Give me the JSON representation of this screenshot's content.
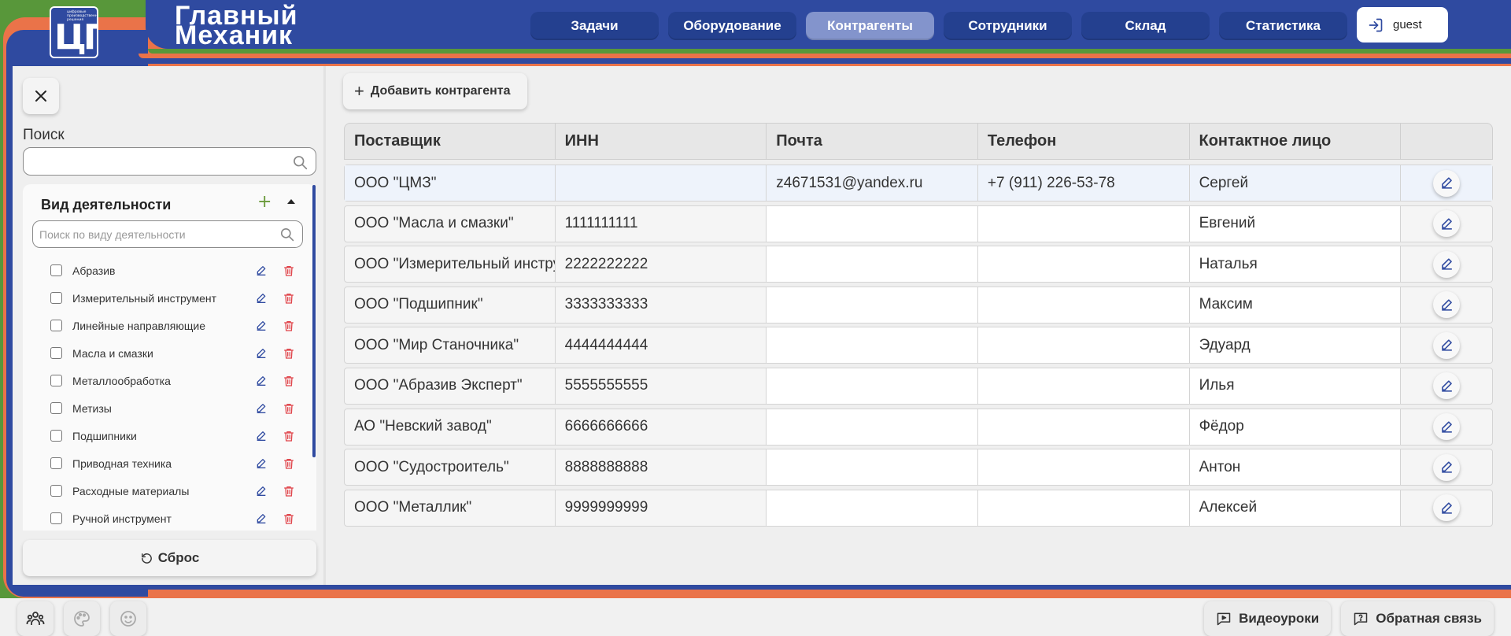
{
  "brand": {
    "logo_small_text": "цифровые производственные решения",
    "logo_letters": "ЦПР",
    "title_line1": "Главный",
    "title_line2": "Механик"
  },
  "nav": {
    "items": [
      {
        "label": "Задачи",
        "active": false
      },
      {
        "label": "Оборудование",
        "active": false
      },
      {
        "label": "Контрагенты",
        "active": true
      },
      {
        "label": "Сотрудники",
        "active": false
      },
      {
        "label": "Склад",
        "active": false
      },
      {
        "label": "Статистика",
        "active": false
      }
    ],
    "user": "guest"
  },
  "sidebar": {
    "search_label": "Поиск",
    "search_value": "",
    "filter_title": "Вид деятельности",
    "filter_search_placeholder": "Поиск по виду деятельности",
    "items": [
      {
        "label": "Абразив"
      },
      {
        "label": "Измерительный инструмент"
      },
      {
        "label": "Линейные направляющие"
      },
      {
        "label": "Масла и смазки"
      },
      {
        "label": "Металлообработка"
      },
      {
        "label": "Метизы"
      },
      {
        "label": "Подшипники"
      },
      {
        "label": "Приводная техника"
      },
      {
        "label": "Расходные материалы"
      },
      {
        "label": "Ручной инструмент"
      }
    ],
    "reset_label": "Сброс"
  },
  "main": {
    "add_button_label": "Добавить контрагента",
    "columns": [
      "Поставщик",
      "ИНН",
      "Почта",
      "Телефон",
      "Контактное лицо",
      ""
    ],
    "rows": [
      {
        "supplier": "ООО \"ЦМЗ\"",
        "inn": "",
        "email": "z4671531@yandex.ru",
        "phone": "+7 (911) 226-53-78",
        "contact": "Сергей"
      },
      {
        "supplier": "ООО \"Масла и смазки\"",
        "inn": "1111111111",
        "email": "",
        "phone": "",
        "contact": "Евгений"
      },
      {
        "supplier": "ООО \"Измерительный инструмент\"",
        "inn": "2222222222",
        "email": "",
        "phone": "",
        "contact": "Наталья"
      },
      {
        "supplier": "ООО \"Подшипник\"",
        "inn": "3333333333",
        "email": "",
        "phone": "",
        "contact": "Максим"
      },
      {
        "supplier": "ООО \"Мир Станочника\"",
        "inn": "4444444444",
        "email": "",
        "phone": "",
        "contact": "Эдуард"
      },
      {
        "supplier": "ООО \"Абразив Эксперт\"",
        "inn": "5555555555",
        "email": "",
        "phone": "",
        "contact": "Илья"
      },
      {
        "supplier": "АО \"Невский завод\"",
        "inn": "6666666666",
        "email": "",
        "phone": "",
        "contact": "Фёдор"
      },
      {
        "supplier": "ООО \"Судостроитель\"",
        "inn": "8888888888",
        "email": "",
        "phone": "",
        "contact": "Антон"
      },
      {
        "supplier": "ООО \"Металлик\"",
        "inn": "9999999999",
        "email": "",
        "phone": "",
        "contact": "Алексей"
      }
    ]
  },
  "footer": {
    "video_label": "Видеоуроки",
    "feedback_label": "Обратная связь"
  },
  "colors": {
    "brand_blue": "#2f4aa0",
    "active_nav": "#8394cc",
    "frame_green": "#58973a",
    "frame_orange": "#ea7349",
    "delete_red": "#e0454b",
    "edit_blue": "#2f4aa0"
  },
  "icons": {
    "close": "close-icon",
    "search": "search-icon",
    "add": "plus-icon",
    "collapse": "caret-up-icon",
    "edit": "pencil-icon",
    "delete": "trash-icon",
    "reset": "reset-icon",
    "login": "login-icon",
    "users": "users-icon",
    "palette": "palette-icon",
    "smile": "smile-icon",
    "video": "video-chat-icon",
    "feedback": "help-chat-icon"
  }
}
